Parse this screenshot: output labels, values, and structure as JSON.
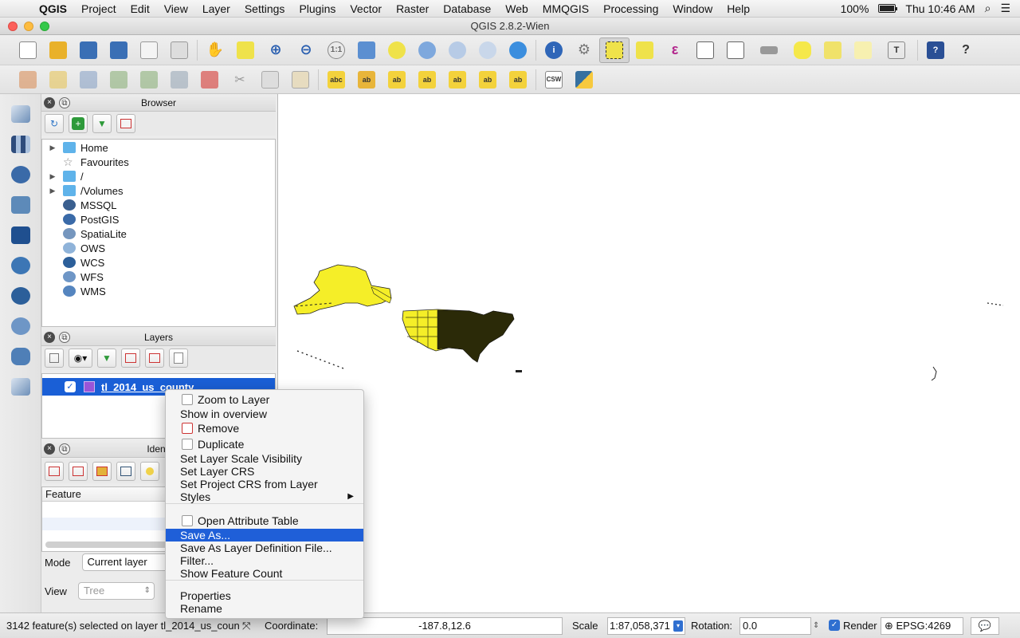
{
  "menubar": {
    "app": "QGIS",
    "items": [
      "Project",
      "Edit",
      "View",
      "Layer",
      "Settings",
      "Plugins",
      "Vector",
      "Raster",
      "Database",
      "Web",
      "MMQGIS",
      "Processing",
      "Window",
      "Help"
    ],
    "battery": "100%",
    "battery_level": 1.0,
    "clock": "Thu 10:46 AM"
  },
  "window": {
    "title": "QGIS 2.8.2-Wien"
  },
  "browser": {
    "title": "Browser",
    "items": [
      {
        "label": "Home",
        "icon": "folder-icon",
        "expandable": true
      },
      {
        "label": "Favourites",
        "icon": "star-icon",
        "expandable": false
      },
      {
        "label": "/",
        "icon": "folder-icon",
        "expandable": true
      },
      {
        "label": "/Volumes",
        "icon": "folder-icon",
        "expandable": true
      },
      {
        "label": "MSSQL",
        "icon": "mssql-icon",
        "expandable": false
      },
      {
        "label": "PostGIS",
        "icon": "postgis-icon",
        "expandable": false
      },
      {
        "label": "SpatiaLite",
        "icon": "spatialite-icon",
        "expandable": false
      },
      {
        "label": "OWS",
        "icon": "ows-icon",
        "expandable": false
      },
      {
        "label": "WCS",
        "icon": "wcs-icon",
        "expandable": false
      },
      {
        "label": "WFS",
        "icon": "wfs-icon",
        "expandable": false
      },
      {
        "label": "WMS",
        "icon": "wms-icon",
        "expandable": false
      }
    ]
  },
  "layers": {
    "title": "Layers",
    "items": [
      {
        "name": "tl_2014_us_county",
        "checked": true,
        "color": "#9a55d8"
      }
    ]
  },
  "identify": {
    "title": "Identi",
    "column": "Feature",
    "mode_label": "Mode",
    "mode_value": "Current layer",
    "view_label": "View",
    "view_value": "Tree"
  },
  "context_menu": {
    "items": [
      {
        "label": "Zoom to Layer",
        "icon": "zoom-icon"
      },
      {
        "label": "Show in overview"
      },
      {
        "label": "Remove",
        "icon": "remove-icon"
      },
      {
        "label": "Duplicate",
        "icon": "duplicate-icon"
      },
      {
        "label": "Set Layer Scale Visibility"
      },
      {
        "label": "Set Layer CRS"
      },
      {
        "label": "Set Project CRS from Layer"
      },
      {
        "label": "Styles",
        "submenu": true
      },
      {
        "label": "Open Attribute Table",
        "icon": "table-icon"
      },
      {
        "label": "Save As...",
        "highlighted": true
      },
      {
        "label": "Save As Layer Definition File..."
      },
      {
        "label": "Filter..."
      },
      {
        "label": "Show Feature Count"
      },
      {
        "label": "Properties"
      },
      {
        "label": "Rename"
      }
    ]
  },
  "statusbar": {
    "message": "3142 feature(s) selected on layer tl_2014_us_coun",
    "coordinate_label": "Coordinate:",
    "coordinate_value": "-187.8,12.6",
    "scale_label": "Scale",
    "scale_value": "1:87,058,371",
    "rotation_label": "Rotation:",
    "rotation_value": "0.0",
    "render_label": "Render",
    "render_checked": true,
    "crs": "EPSG:4269"
  },
  "colors": {
    "selection": "#1f5fd8",
    "feature_fill": "#f5ee28",
    "feature_stroke": "#222222"
  }
}
